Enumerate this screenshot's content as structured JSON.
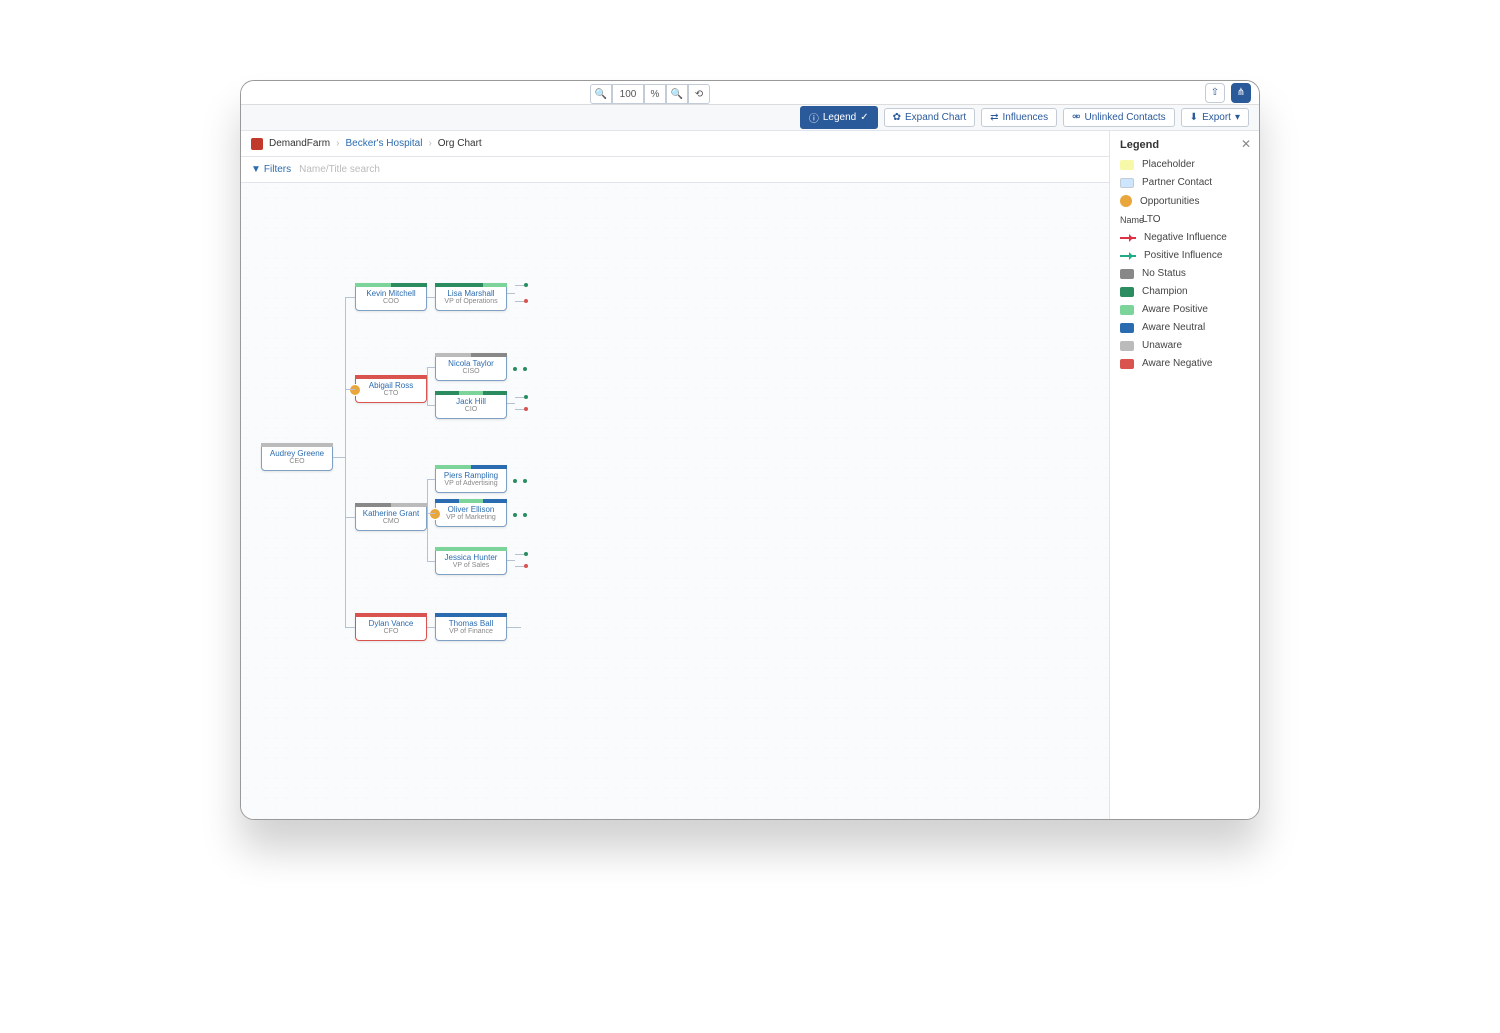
{
  "app_brand": "DemandFarm",
  "breadcrumbs": {
    "account": "Becker's Hospital",
    "page": "Org Chart"
  },
  "filter": {
    "label": "Filters",
    "placeholder": "Name/Title search"
  },
  "zoom": {
    "level": "100"
  },
  "toolbar": {
    "legend_btn": "Legend",
    "expand_btn": "Expand Chart",
    "influences_btn": "Influences",
    "unlinked_btn": "Unlinked Contacts",
    "export_btn": "Export"
  },
  "legend": {
    "title": "Legend",
    "items": [
      {
        "kind": "swatch",
        "color": "#f7f9a8",
        "label": "Placeholder"
      },
      {
        "kind": "swatch-outline",
        "color": "#cde5ff",
        "label": "Partner Contact"
      },
      {
        "kind": "circle",
        "color": "#e8a63c",
        "label": "Opportunities"
      },
      {
        "kind": "textsw",
        "badge": "Name",
        "label": "LTO"
      },
      {
        "kind": "arrow-red",
        "label": "Negative Influence"
      },
      {
        "kind": "arrow-green",
        "label": "Positive Influence"
      },
      {
        "kind": "swatch",
        "color": "#888888",
        "label": "No Status"
      },
      {
        "kind": "swatch",
        "color": "#2a8c5f",
        "label": "Champion"
      },
      {
        "kind": "swatch",
        "color": "#7dd49a",
        "label": "Aware Positive"
      },
      {
        "kind": "swatch",
        "color": "#2b6cb0",
        "label": "Aware Neutral"
      },
      {
        "kind": "swatch",
        "color": "#bbbbbb",
        "label": "Unaware"
      },
      {
        "kind": "swatch",
        "color": "#d9534f",
        "label": "Aware Negative"
      }
    ]
  },
  "nodes": {
    "audrey": {
      "name": "Audrey Greene",
      "title": "CEO"
    },
    "kevin": {
      "name": "Kevin Mitchell",
      "title": "COO"
    },
    "lisa": {
      "name": "Lisa Marshall",
      "title": "VP of Operations"
    },
    "abigail": {
      "name": "Abigail Ross",
      "title": "CTO"
    },
    "nicola": {
      "name": "Nicola Taylor",
      "title": "CISO"
    },
    "jack": {
      "name": "Jack Hill",
      "title": "CIO"
    },
    "katherine": {
      "name": "Katherine Grant",
      "title": "CMO"
    },
    "piers": {
      "name": "Piers Rampling",
      "title": "VP of Advertising"
    },
    "oliver": {
      "name": "Oliver Ellison",
      "title": "VP of Marketing"
    },
    "jessica": {
      "name": "Jessica Hunter",
      "title": "VP of Sales"
    },
    "dylan": {
      "name": "Dylan Vance",
      "title": "CFO"
    },
    "thomas": {
      "name": "Thomas Ball",
      "title": "VP of Finance"
    }
  }
}
